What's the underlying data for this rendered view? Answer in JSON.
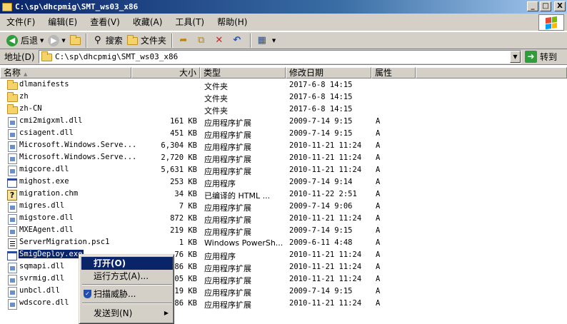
{
  "window": {
    "title": "C:\\sp\\dhcpmig\\SMT_ws03_x86",
    "minimize": "_",
    "maximize": "□",
    "close": "X"
  },
  "menu": [
    "文件(F)",
    "编辑(E)",
    "查看(V)",
    "收藏(A)",
    "工具(T)",
    "帮助(H)"
  ],
  "toolbar": {
    "back": "后退",
    "search": "搜索",
    "folders": "文件夹"
  },
  "address": {
    "label": "地址(D)",
    "path": "C:\\sp\\dhcpmig\\SMT_ws03_x86",
    "go": "转到"
  },
  "columns": {
    "name": "名称",
    "size": "大小",
    "type": "类型",
    "modified": "修改日期",
    "attributes": "属性"
  },
  "files": [
    {
      "name": "dlmanifests",
      "size": "",
      "type": "文件夹",
      "date": "2017-6-8 14:15",
      "attr": "",
      "icon": "folder"
    },
    {
      "name": "zh",
      "size": "",
      "type": "文件夹",
      "date": "2017-6-8 14:15",
      "attr": "",
      "icon": "folder"
    },
    {
      "name": "zh-CN",
      "size": "",
      "type": "文件夹",
      "date": "2017-6-8 14:15",
      "attr": "",
      "icon": "folder"
    },
    {
      "name": "cmi2migxml.dll",
      "size": "161 KB",
      "type": "应用程序扩展",
      "date": "2009-7-14 9:15",
      "attr": "A",
      "icon": "dll"
    },
    {
      "name": "csiagent.dll",
      "size": "451 KB",
      "type": "应用程序扩展",
      "date": "2009-7-14 9:15",
      "attr": "A",
      "icon": "dll"
    },
    {
      "name": "Microsoft.Windows.Serve...",
      "size": "6,304 KB",
      "type": "应用程序扩展",
      "date": "2010-11-21 11:24",
      "attr": "A",
      "icon": "dll"
    },
    {
      "name": "Microsoft.Windows.Serve...",
      "size": "2,720 KB",
      "type": "应用程序扩展",
      "date": "2010-11-21 11:24",
      "attr": "A",
      "icon": "dll"
    },
    {
      "name": "migcore.dll",
      "size": "5,631 KB",
      "type": "应用程序扩展",
      "date": "2010-11-21 11:24",
      "attr": "A",
      "icon": "dll"
    },
    {
      "name": "mighost.exe",
      "size": "253 KB",
      "type": "应用程序",
      "date": "2009-7-14 9:14",
      "attr": "A",
      "icon": "exe-gear"
    },
    {
      "name": "migration.chm",
      "size": "34 KB",
      "type": "已编译的 HTML ...",
      "date": "2010-11-22 2:51",
      "attr": "A",
      "icon": "chm"
    },
    {
      "name": "migres.dll",
      "size": "7 KB",
      "type": "应用程序扩展",
      "date": "2009-7-14 9:06",
      "attr": "A",
      "icon": "dll"
    },
    {
      "name": "migstore.dll",
      "size": "872 KB",
      "type": "应用程序扩展",
      "date": "2010-11-21 11:24",
      "attr": "A",
      "icon": "dll"
    },
    {
      "name": "MXEAgent.dll",
      "size": "219 KB",
      "type": "应用程序扩展",
      "date": "2009-7-14 9:15",
      "attr": "A",
      "icon": "dll"
    },
    {
      "name": "ServerMigration.psc1",
      "size": "1 KB",
      "type": "Windows PowerSh...",
      "date": "2009-6-11 4:48",
      "attr": "A",
      "icon": "ps1"
    },
    {
      "name": "SmigDeploy.exe",
      "size": "76 KB",
      "type": "应用程序",
      "date": "2010-11-21 11:24",
      "attr": "A",
      "icon": "exe"
    },
    {
      "name": "sqmapi.dll",
      "size": "86 KB",
      "type": "应用程序扩展",
      "date": "2010-11-21 11:24",
      "attr": "A",
      "icon": "dll"
    },
    {
      "name": "svrmig.dll",
      "size": "05 KB",
      "type": "应用程序扩展",
      "date": "2010-11-21 11:24",
      "attr": "A",
      "icon": "dll"
    },
    {
      "name": "unbcl.dll",
      "size": "19 KB",
      "type": "应用程序扩展",
      "date": "2009-7-14 9:15",
      "attr": "A",
      "icon": "dll"
    },
    {
      "name": "wdscore.dll",
      "size": "86 KB",
      "type": "应用程序扩展",
      "date": "2010-11-21 11:24",
      "attr": "A",
      "icon": "dll"
    }
  ],
  "selected_index": 14,
  "context_menu": {
    "open": "打开(O)",
    "run_as": "运行方式(A)...",
    "scan": "扫描威胁...",
    "send_to": "发送到(N)"
  },
  "colors": {
    "titlebar": "#0a246a",
    "chrome": "#d4d0c8",
    "selection": "#0a246a"
  }
}
